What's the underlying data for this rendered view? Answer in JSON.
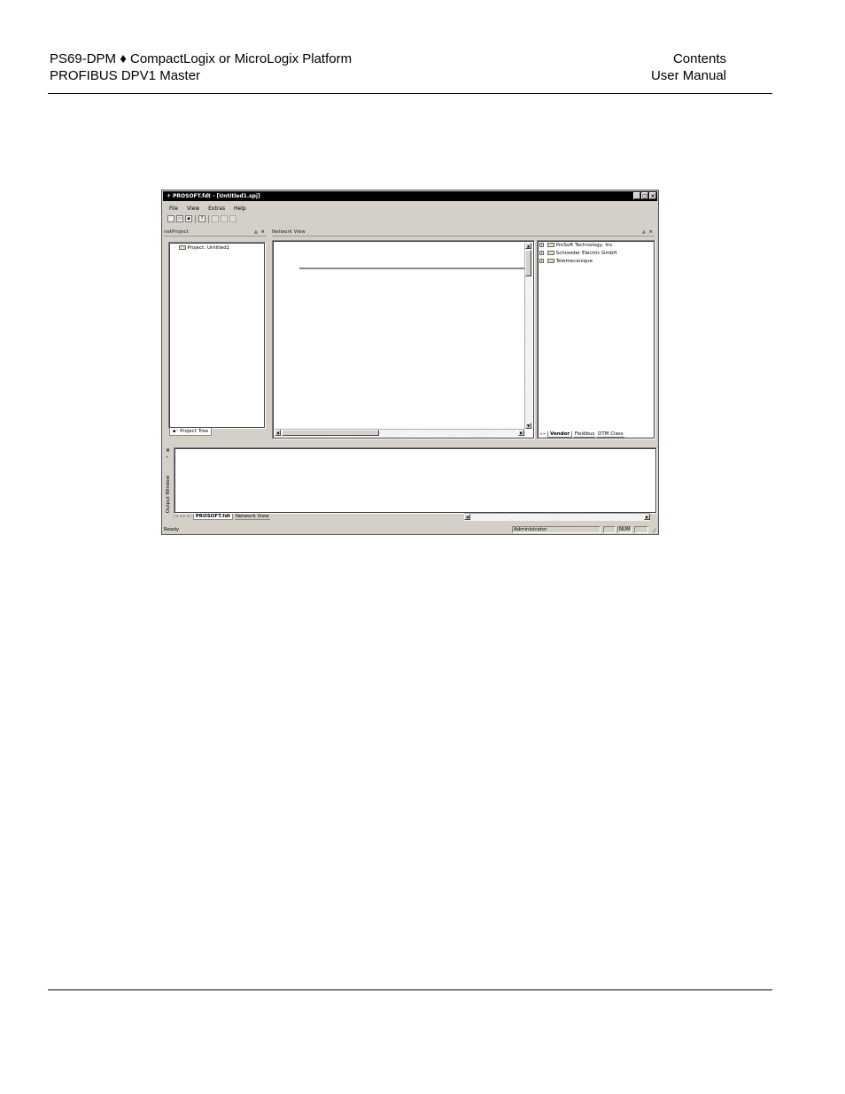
{
  "header": {
    "left_line1": "PS69-DPM ♦ CompactLogix or MicroLogix Platform",
    "left_line2": "PROFIBUS DPV1 Master",
    "right_line1": "Contents",
    "right_line2": "User Manual"
  },
  "window": {
    "title": "PROSOFT.fdt - [Untitled1.spj]",
    "menu": [
      "File",
      "View",
      "Extras",
      "Help"
    ],
    "project_pane": {
      "title": "netProject",
      "tree_root": "Project: Untitled1",
      "tab": "Project Tree"
    },
    "network_pane": {
      "title": "Network View"
    },
    "catalog_pane": {
      "vendors": [
        "ProSoft Technology, Inc.",
        "Schneider Electric GmbH",
        "Telemecanique"
      ],
      "tabs": [
        "Vendor",
        "Fieldbus",
        "DTM Class"
      ]
    },
    "output": {
      "side_label": "Output Window",
      "tabs": [
        "PROSOFT.fdt",
        "Network View"
      ]
    },
    "status": {
      "text": "Ready",
      "user": "Administrator",
      "num": "NUM"
    }
  }
}
